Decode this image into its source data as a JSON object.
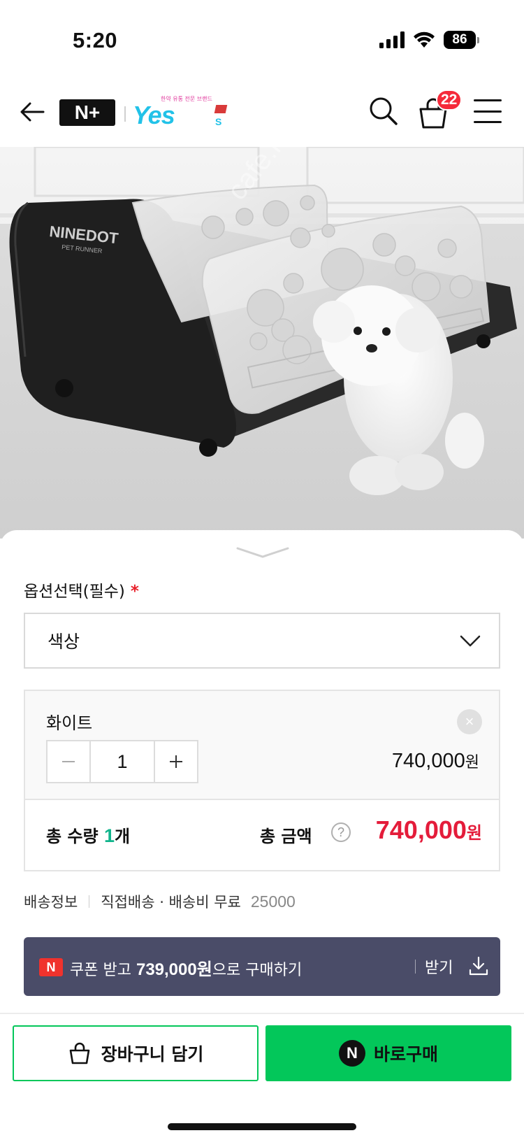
{
  "status_bar": {
    "time": "5:20",
    "battery": "86"
  },
  "header": {
    "cart_count": "22"
  },
  "logos": {
    "platform": "N+",
    "store_name": "Yes",
    "store_sub": "한약 유통 전문 브랜드"
  },
  "watermark": {
    "text_1": "cafe.naver.com/joonggonara",
    "text_2": "cafe.naver.com/joonggonara"
  },
  "image": {
    "brand_text": "NINEDOT",
    "brand_sub": "PET RUNNER"
  },
  "options": {
    "title": "옵션선택(필수)",
    "required_mark": "*",
    "select_value": "색상"
  },
  "selected_item": {
    "name": "화이트",
    "remove_symbol": "×",
    "quantity": "1",
    "price": "740,000",
    "price_unit": "원"
  },
  "total": {
    "qty_label": "총 수량",
    "qty": "1",
    "qty_unit": "개",
    "amount_label": "총 금액",
    "help_symbol": "?",
    "amount": "740,000",
    "amount_unit": "원"
  },
  "delivery": {
    "label": "배송정보",
    "method": "직접배송 · 배송비 무료",
    "code": "25000"
  },
  "coupon": {
    "badge": "N",
    "text_prefix": "쿠폰 받고",
    "amount": "739,000원",
    "text_suffix": "으로 구매하기",
    "get_label": "받기"
  },
  "actions": {
    "cart_label": "장바구니 담기",
    "buy_badge": "N",
    "buy_label": "바로구매"
  },
  "colors": {
    "accent_green": "#03c75a",
    "price_red": "#e41c3a",
    "coupon_bg": "#4a4c68",
    "badge_red": "#f52a3a"
  },
  "icons": [
    "back-arrow-icon",
    "search-icon",
    "shopping-bag-icon",
    "hamburger-menu-icon",
    "chevron-down-icon",
    "close-icon",
    "minus-icon",
    "plus-icon",
    "help-icon",
    "download-icon",
    "cart-bag-icon",
    "npay-icon"
  ]
}
